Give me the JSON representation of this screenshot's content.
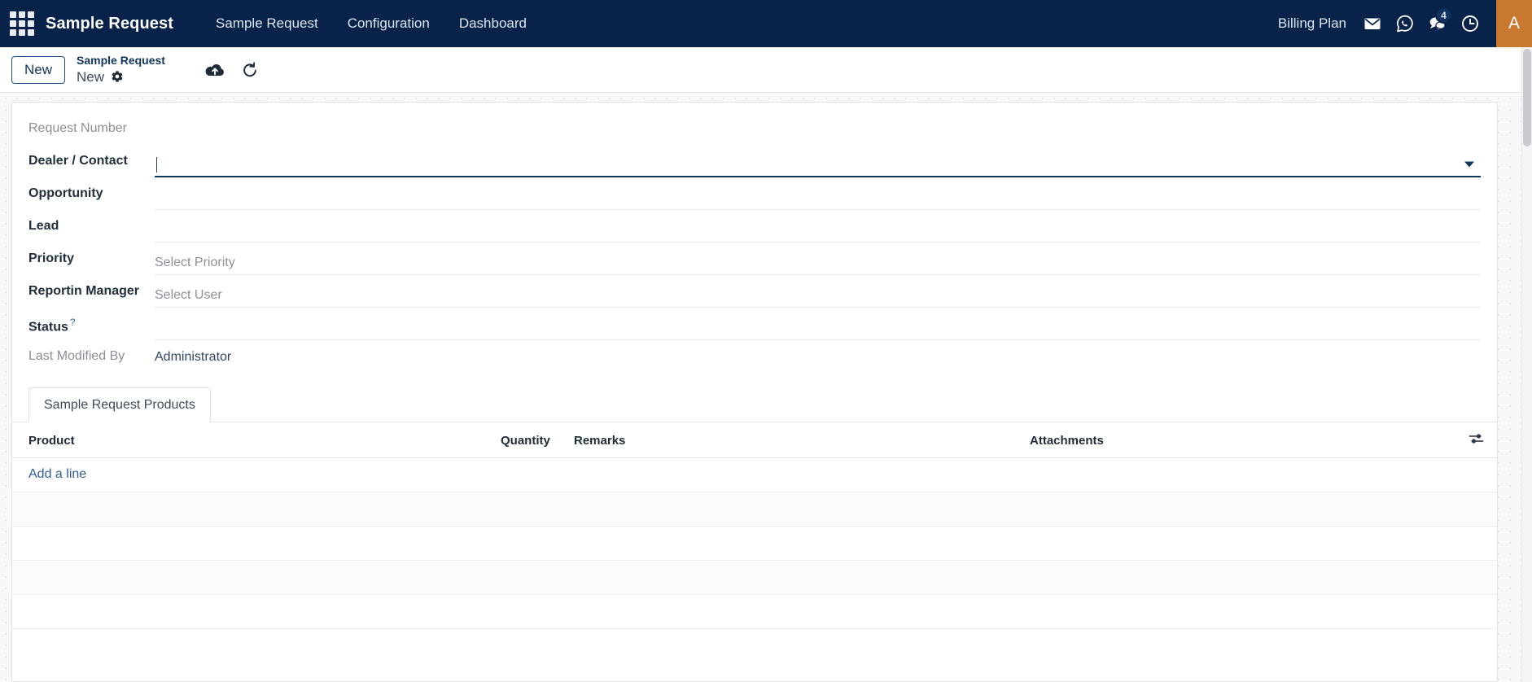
{
  "navbar": {
    "apps_icon": "apps-grid-icon",
    "brand": "Sample Request",
    "links": [
      {
        "label": "Sample Request"
      },
      {
        "label": "Configuration"
      },
      {
        "label": "Dashboard"
      }
    ],
    "billing_plan": "Billing Plan",
    "icons": [
      {
        "name": "mail-icon",
        "glyph": "✉"
      },
      {
        "name": "whatsapp-icon",
        "glyph": "○"
      },
      {
        "name": "messages-icon",
        "glyph": "὞A",
        "badge": "4"
      },
      {
        "name": "activity-clock-icon",
        "glyph": "◴"
      }
    ],
    "messages_badge": "4",
    "avatar_initial": "A",
    "avatar_color": "#c9782f",
    "background_color": "#08224a"
  },
  "control_panel": {
    "new_button": "New",
    "breadcrumb_parent": "Sample Request",
    "breadcrumb_current": "New",
    "gear_icon": "gear-icon",
    "save_icon": "cloud-upload-save-icon",
    "discard_icon": "undo-discard-icon"
  },
  "form": {
    "fields": [
      {
        "label": "Request Number",
        "muted": true,
        "type": "readonly",
        "value": "",
        "placeholder": ""
      },
      {
        "label": "Dealer / Contact",
        "muted": false,
        "type": "many2one-focused",
        "value": "",
        "placeholder": ""
      },
      {
        "label": "Opportunity",
        "muted": false,
        "type": "text",
        "value": "",
        "placeholder": ""
      },
      {
        "label": "Lead",
        "muted": false,
        "type": "text",
        "value": "",
        "placeholder": ""
      },
      {
        "label": "Priority",
        "muted": false,
        "type": "select",
        "value": "",
        "placeholder": "Select Priority"
      },
      {
        "label": "Reportin Manager",
        "muted": false,
        "type": "select",
        "value": "",
        "placeholder": "Select User"
      },
      {
        "label": "Status",
        "muted": false,
        "type": "text",
        "value": "",
        "placeholder": "",
        "help": "?"
      },
      {
        "label": "Last Modified By",
        "muted": true,
        "type": "static",
        "value": "Administrator",
        "placeholder": ""
      }
    ]
  },
  "notebook": {
    "tabs": [
      {
        "label": "Sample Request Products",
        "active": true
      }
    ]
  },
  "list": {
    "columns": [
      "Product",
      "Quantity",
      "Remarks",
      "Attachments"
    ],
    "optional_columns_icon": "sliders-optional-columns-icon",
    "add_line_label": "Add a line",
    "rows": []
  }
}
